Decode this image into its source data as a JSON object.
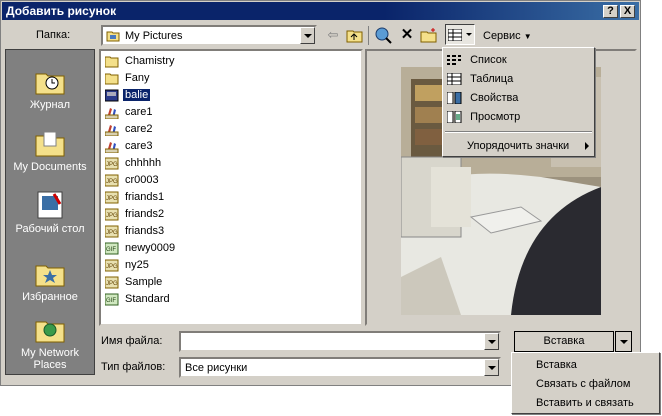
{
  "window": {
    "title": "Добавить рисунок",
    "help": "?",
    "close": "X"
  },
  "toolbar": {
    "folder_label": "Папка:",
    "folder_value": "My Pictures",
    "service_label": "Сервис"
  },
  "places": [
    {
      "label": "Журнал"
    },
    {
      "label": "My Documents"
    },
    {
      "label": "Рабочий стол"
    },
    {
      "label": "Избранное"
    },
    {
      "label": "My Network Places"
    }
  ],
  "files": [
    {
      "name": "Chamistry",
      "type": "folder"
    },
    {
      "name": "Fany",
      "type": "folder"
    },
    {
      "name": "balie",
      "type": "bmp",
      "selected": true
    },
    {
      "name": "care1",
      "type": "paint"
    },
    {
      "name": "care2",
      "type": "paint"
    },
    {
      "name": "care3",
      "type": "paint"
    },
    {
      "name": "chhhhh",
      "type": "jpg"
    },
    {
      "name": "cr0003",
      "type": "jpg"
    },
    {
      "name": "friands1",
      "type": "jpg"
    },
    {
      "name": "friands2",
      "type": "jpg"
    },
    {
      "name": "friands3",
      "type": "jpg"
    },
    {
      "name": "newy0009",
      "type": "gif"
    },
    {
      "name": "ny25",
      "type": "jpg"
    },
    {
      "name": "Sample",
      "type": "jpg"
    },
    {
      "name": "Standard",
      "type": "gif"
    }
  ],
  "view_menu": {
    "items": [
      "Список",
      "Таблица",
      "Свойства",
      "Просмотр"
    ],
    "arrange": "Упорядочить значки"
  },
  "bottom": {
    "filename_label": "Имя файла:",
    "filename_value": "",
    "filetype_label": "Тип файлов:",
    "filetype_value": "Все рисунки",
    "insert_button": "Вставка"
  },
  "insert_menu": {
    "items": [
      "Вставка",
      "Связать с файлом",
      "Вставить и связать"
    ]
  },
  "colors": {
    "titlebar": "#0a246a",
    "selection": "#0a246a",
    "face": "#d4d0c8"
  }
}
